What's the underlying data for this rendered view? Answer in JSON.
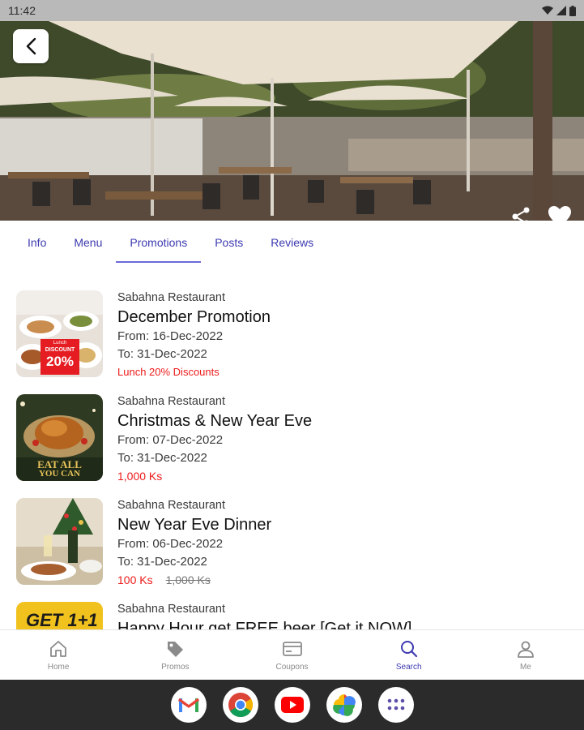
{
  "status_bar": {
    "time": "11:42"
  },
  "tabs": [
    {
      "label": "Info"
    },
    {
      "label": "Menu"
    },
    {
      "label": "Promotions"
    },
    {
      "label": "Posts"
    },
    {
      "label": "Reviews"
    }
  ],
  "active_tab": "Promotions",
  "promotions": [
    {
      "restaurant": "Sabahna Restaurant",
      "title": "December Promotion",
      "from": "From: 16-Dec-2022",
      "to": "To: 31-Dec-2022",
      "price": "Lunch 20% Discounts",
      "thumb_text": {
        "line1": "Lunch",
        "line2": "DISCOUNT",
        "line3": "20%"
      }
    },
    {
      "restaurant": "Sabahna Restaurant",
      "title": "Christmas & New Year Eve",
      "from": "From: 07-Dec-2022",
      "to": "To: 31-Dec-2022",
      "price": "1,000 Ks",
      "thumb_text": {
        "line1": "EAT ALL",
        "line2": "YOU CAN"
      }
    },
    {
      "restaurant": "Sabahna Restaurant",
      "title": "New Year Eve Dinner",
      "from": "From: 06-Dec-2022",
      "to": "To: 31-Dec-2022",
      "price": "100 Ks",
      "old_price": "1,000 Ks"
    },
    {
      "restaurant": "Sabahna Restaurant",
      "title": "Happy Hour get FREE beer [Get it NOW]",
      "thumb_text": {
        "line1": "GET 1+1"
      }
    }
  ],
  "bottom_nav": [
    {
      "label": "Home",
      "icon": "home-icon"
    },
    {
      "label": "Promos",
      "icon": "tag-icon"
    },
    {
      "label": "Coupons",
      "icon": "coupon-icon"
    },
    {
      "label": "Search",
      "icon": "search-icon"
    },
    {
      "label": "Me",
      "icon": "person-icon"
    }
  ],
  "active_nav": "Search",
  "dock_apps": [
    "gmail-app-icon",
    "chrome-app-icon",
    "youtube-app-icon",
    "photos-app-icon",
    "app-drawer-icon"
  ],
  "colors": {
    "accent": "#3d3ab0",
    "price_red": "#ee1b1b",
    "underline": "#6c6ad8"
  }
}
